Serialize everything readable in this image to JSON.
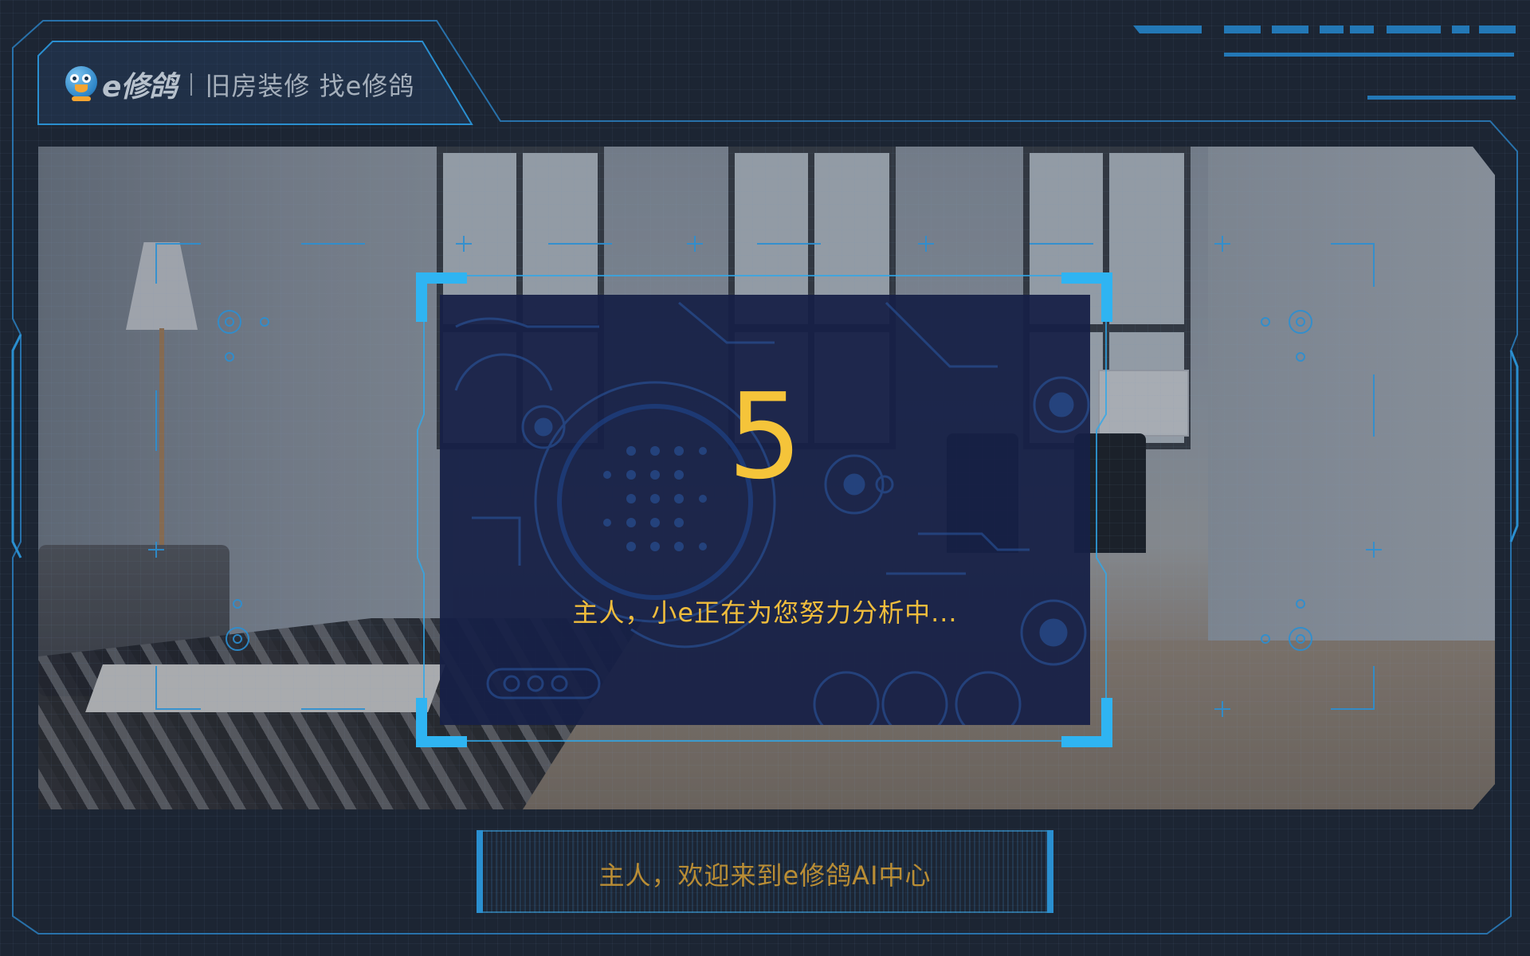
{
  "brand": {
    "name": "e修鸽",
    "slogan": "旧房装修 找e修鸽"
  },
  "analysis": {
    "countdown": "5",
    "status_text": "主人，小e正在为您努力分析中..."
  },
  "welcome": {
    "text": "主人，欢迎来到e修鸽AI中心"
  },
  "colors": {
    "accent_cyan": "#2fb4f2",
    "accent_yellow": "#f5c43a",
    "frame_blue": "#2a8fd0",
    "panel_navy": "#162046"
  },
  "icons": [
    "pigeon-mascot-icon",
    "crosshair-icon",
    "target-circle-icon"
  ]
}
